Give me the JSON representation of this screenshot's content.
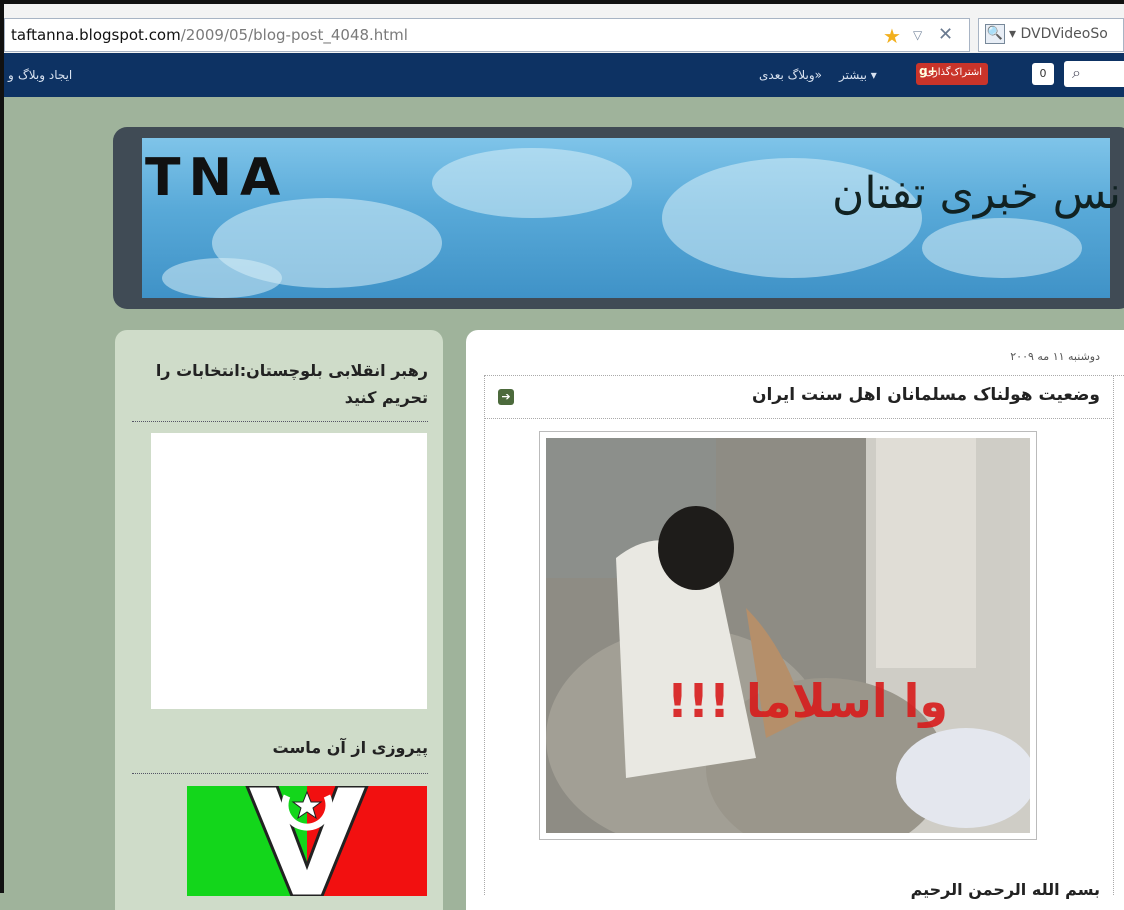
{
  "browser": {
    "url_host": "taftanna.blogspot.com",
    "url_path": "/2009/05/blog-post_4048.html",
    "search_engine": "DVDVideoSo"
  },
  "navbar": {
    "create_blog": "ایجاد وبلاگ",
    "create_extra": "و",
    "next_blog": "وبلاگ بعدی»",
    "more": "بیشتر ▾",
    "share": "اشتراک‌گذاری",
    "count": "0"
  },
  "header": {
    "logo": "TNA",
    "agency_name": "آژانس خبری تفتان"
  },
  "sidebar": {
    "widget1_title": "رهبر انقلابی بلوچستان:انتخابات را تحریم کنید",
    "widget2_title": "پیروزی از آن ماست"
  },
  "post": {
    "date": "دوشنبه ۱۱ مه ۲۰۰۹",
    "title": "وضعیت هولناک مسلمانان اهل سنت ایران",
    "image_overlay_text": "وا اسلاما !!!",
    "body_start": "بسم الله الرحمن الرحیم"
  },
  "colors": {
    "page_bg": "#9fb39b",
    "navbar_bg": "#0d3263",
    "header_frame": "#404b55",
    "sidebar_bg": "#cfdcc9",
    "overlay_red": "#d81c1c"
  }
}
